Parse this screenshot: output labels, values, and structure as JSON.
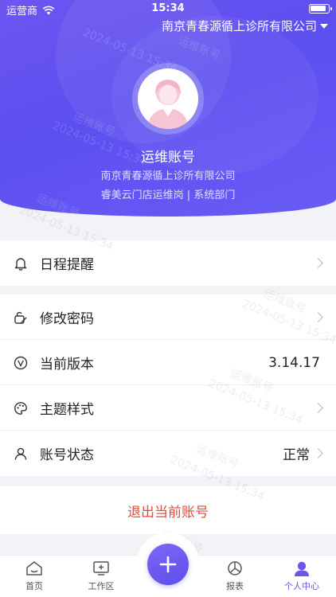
{
  "status_bar": {
    "carrier": "运营商",
    "time": "15:34"
  },
  "header": {
    "org_selector": "南京青春源循上诊所有限公司",
    "account_name": "运维账号",
    "company": "南京青春源循上诊所有限公司",
    "department": "睿美云门店运维岗 | 系统部门"
  },
  "menu": {
    "schedule": {
      "label": "日程提醒"
    },
    "password": {
      "label": "修改密码"
    },
    "version": {
      "label": "当前版本",
      "value": "3.14.17"
    },
    "theme": {
      "label": "主题样式"
    },
    "account_status": {
      "label": "账号状态",
      "value": "正常"
    }
  },
  "logout": "退出当前账号",
  "tabbar": {
    "home": "首页",
    "workspace": "工作区",
    "reports": "报表",
    "profile": "个人中心"
  },
  "watermark": {
    "name": "运维账号",
    "date": "2024-05-13 15:34"
  },
  "colors": {
    "accent": "#6a55f0",
    "danger": "#e34a3c"
  }
}
